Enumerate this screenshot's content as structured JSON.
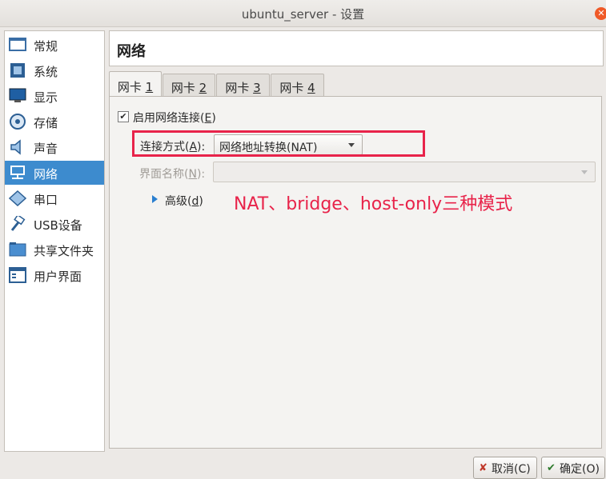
{
  "window": {
    "title": "ubuntu_server - 设置"
  },
  "sidebar": {
    "items": [
      {
        "label": "常规",
        "icon": "general-icon"
      },
      {
        "label": "系统",
        "icon": "system-chip-icon"
      },
      {
        "label": "显示",
        "icon": "monitor-icon"
      },
      {
        "label": "存储",
        "icon": "disk-icon"
      },
      {
        "label": "声音",
        "icon": "speaker-icon"
      },
      {
        "label": "网络",
        "icon": "network-icon",
        "selected": true
      },
      {
        "label": "串口",
        "icon": "serial-port-icon"
      },
      {
        "label": "USB设备",
        "icon": "usb-icon"
      },
      {
        "label": "共享文件夹",
        "icon": "folder-icon"
      },
      {
        "label": "用户界面",
        "icon": "user-interface-icon"
      }
    ]
  },
  "page": {
    "title": "网络"
  },
  "tabs": [
    {
      "label": "网卡 ",
      "key": "1",
      "active": true
    },
    {
      "label": "网卡 ",
      "key": "2"
    },
    {
      "label": "网卡 ",
      "key": "3"
    },
    {
      "label": "网卡 ",
      "key": "4"
    }
  ],
  "adapter": {
    "enable_label": "启用网络连接(",
    "enable_key": "E",
    "enable_suffix": ")",
    "enabled": true,
    "attached_label": "连接方式(",
    "attached_key": "A",
    "attached_suffix": "):",
    "attached_value": "网络地址转换(NAT)",
    "name_label": "界面名称(",
    "name_key": "N",
    "name_suffix": "):",
    "name_value": "",
    "advanced_label": "高级(",
    "advanced_key": "d",
    "advanced_suffix": ")"
  },
  "annotation": {
    "text": "NAT、bridge、host-only三种模式",
    "color": "#e8234a"
  },
  "buttons": {
    "cancel_label": "取消(C)",
    "ok_label": "确定(O)"
  },
  "colors": {
    "accent": "#3d8bce",
    "annotation": "#e8234a"
  }
}
